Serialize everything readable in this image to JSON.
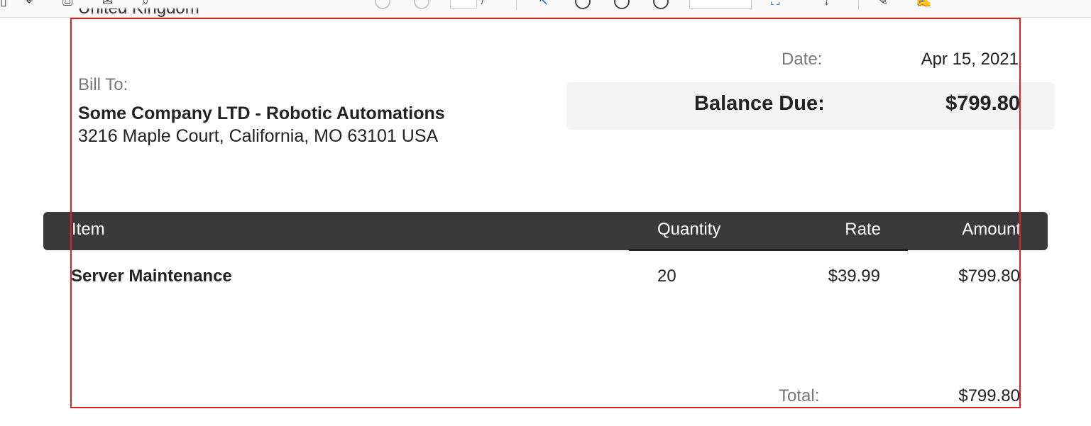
{
  "previous_line": "United Kingdom",
  "invoice": {
    "date_label": "Date:",
    "date_value": "Apr 15, 2021",
    "bill_to_label": "Bill To:",
    "bill_to_name": "Some Company LTD - Robotic Automations",
    "bill_to_address": "3216 Maple Court, California, MO 63101 USA",
    "balance_due_label": "Balance Due:",
    "balance_due_value": "$799.80",
    "table": {
      "headers": {
        "item": "Item",
        "quantity": "Quantity",
        "rate": "Rate",
        "amount": "Amount"
      },
      "rows": [
        {
          "item": "Server Maintenance",
          "quantity": "20",
          "rate": "$39.99",
          "amount": "$799.80"
        }
      ]
    },
    "total_label": "Total:",
    "total_value": "$799.80"
  },
  "colors": {
    "header_bg": "#3a3a3a",
    "balance_bg": "#f4f4f4",
    "selection_border": "#e02020",
    "muted_text": "#777777"
  }
}
